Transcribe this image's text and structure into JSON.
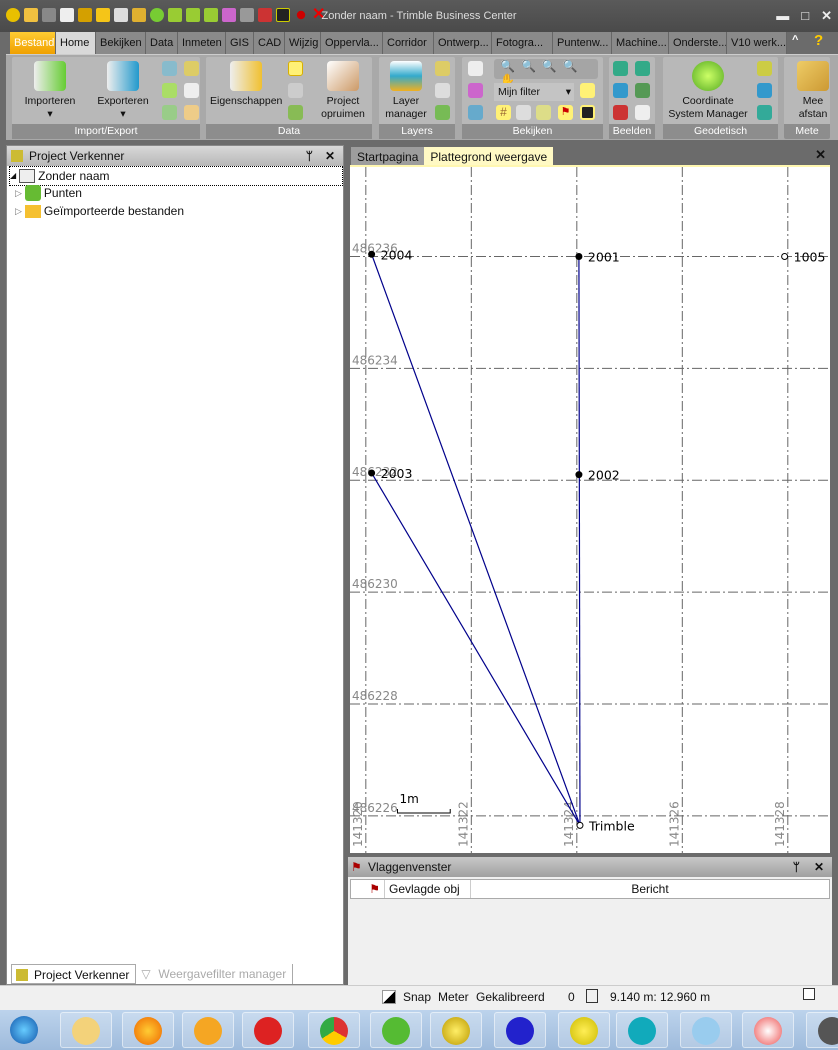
{
  "window": {
    "title": "Zonder naam - Trimble Business Center",
    "minimize": "▬",
    "maximize": "□",
    "close": "✕"
  },
  "ribbon": {
    "tabs": [
      "Bestand",
      "Home",
      "Bekijken",
      "Data",
      "Inmeten",
      "GIS",
      "CAD",
      "Wijzig",
      "Oppervla...",
      "Corridor",
      "Ontwerp...",
      "Fotogra...",
      "Puntenw...",
      "Machine...",
      "Onderste...",
      "V10 werk..."
    ],
    "active_tab": "Home",
    "collapse": "^",
    "help": "?",
    "groups": {
      "import_export": {
        "label": "Import/Export",
        "importeren": "Importeren",
        "exporteren": "Exporteren"
      },
      "data": {
        "label": "Data",
        "eigenschappen": "Eigenschappen",
        "project_opruimen_1": "Project",
        "project_opruimen_2": "opruimen"
      },
      "layers": {
        "label": "Layers",
        "layer_manager_1": "Layer",
        "layer_manager_2": "manager"
      },
      "bekijken": {
        "label": "Bekijken",
        "filter": "Mijn filter"
      },
      "beelden": {
        "label": "Beelden"
      },
      "geodetisch": {
        "label": "Geodetisch",
        "csm_1": "Coordinate",
        "csm_2": "System Manager"
      },
      "meten": {
        "label": "Mete",
        "btn_1": "Mee",
        "btn_2": "afstan"
      }
    }
  },
  "project_explorer": {
    "title": "Project Verkenner",
    "pin": "ᛘ",
    "close": "✕",
    "tree": [
      {
        "label": "Zonder naam"
      },
      {
        "label": "Punten"
      },
      {
        "label": "Geïmporteerde bestanden"
      }
    ],
    "bottom_tabs": [
      "Project Verkenner",
      "Weergavefilter manager"
    ]
  },
  "document_tabs": [
    "Startpagina",
    "Plattegrond weergave"
  ],
  "doc_close": "✕",
  "chart_data": {
    "type": "scatter",
    "title": "",
    "xlim": [
      141319.7,
      141328.8
    ],
    "ylim": [
      486225.3,
      486237.6
    ],
    "x_ticks": [
      "141320",
      "141322",
      "141324",
      "141326",
      "141328"
    ],
    "x_tick_values": [
      141320,
      141322,
      141324,
      141326,
      141328
    ],
    "y_ticks": [
      "486226",
      "486228",
      "486230",
      "486232",
      "486234",
      "486236"
    ],
    "y_tick_values": [
      486226,
      486228,
      486230,
      486232,
      486234,
      486236
    ],
    "grid": true,
    "points": [
      {
        "name": "2004",
        "x": 141320.11,
        "y": 486236.04,
        "symbol": "filled"
      },
      {
        "name": "2001",
        "x": 141324.04,
        "y": 486236.0,
        "symbol": "filled"
      },
      {
        "name": "1005",
        "x": 141327.94,
        "y": 486236.0,
        "symbol": "open"
      },
      {
        "name": "2003",
        "x": 141320.11,
        "y": 486232.13,
        "symbol": "filled"
      },
      {
        "name": "2002",
        "x": 141324.04,
        "y": 486232.1,
        "symbol": "filled"
      },
      {
        "name": "Trimble",
        "x": 141324.06,
        "y": 486225.83,
        "symbol": "open"
      }
    ],
    "lines": [
      [
        "Trimble",
        "2004"
      ],
      [
        "Trimble",
        "2003"
      ],
      [
        "Trimble",
        "2001"
      ]
    ],
    "line_color": "#00008b",
    "scale_bar": "1m"
  },
  "flag_window": {
    "title": "Vlaggenvenster",
    "pin": "ᛘ",
    "close": "✕",
    "columns": [
      "Gevlagde obj",
      "Bericht"
    ]
  },
  "statusbar": {
    "snap": "Snap",
    "units": "Meter",
    "calibrated": "Gekalibreerd",
    "count": "0",
    "coords": "9.140 m: 12.960 m"
  },
  "taskbar": {
    "apps": [
      "start",
      "explorer",
      "firefox",
      "outlook",
      "help",
      "chrome",
      "evernote",
      "globe",
      "trimble-blue",
      "tbc",
      "skype",
      "notepad",
      "color",
      "target"
    ]
  }
}
